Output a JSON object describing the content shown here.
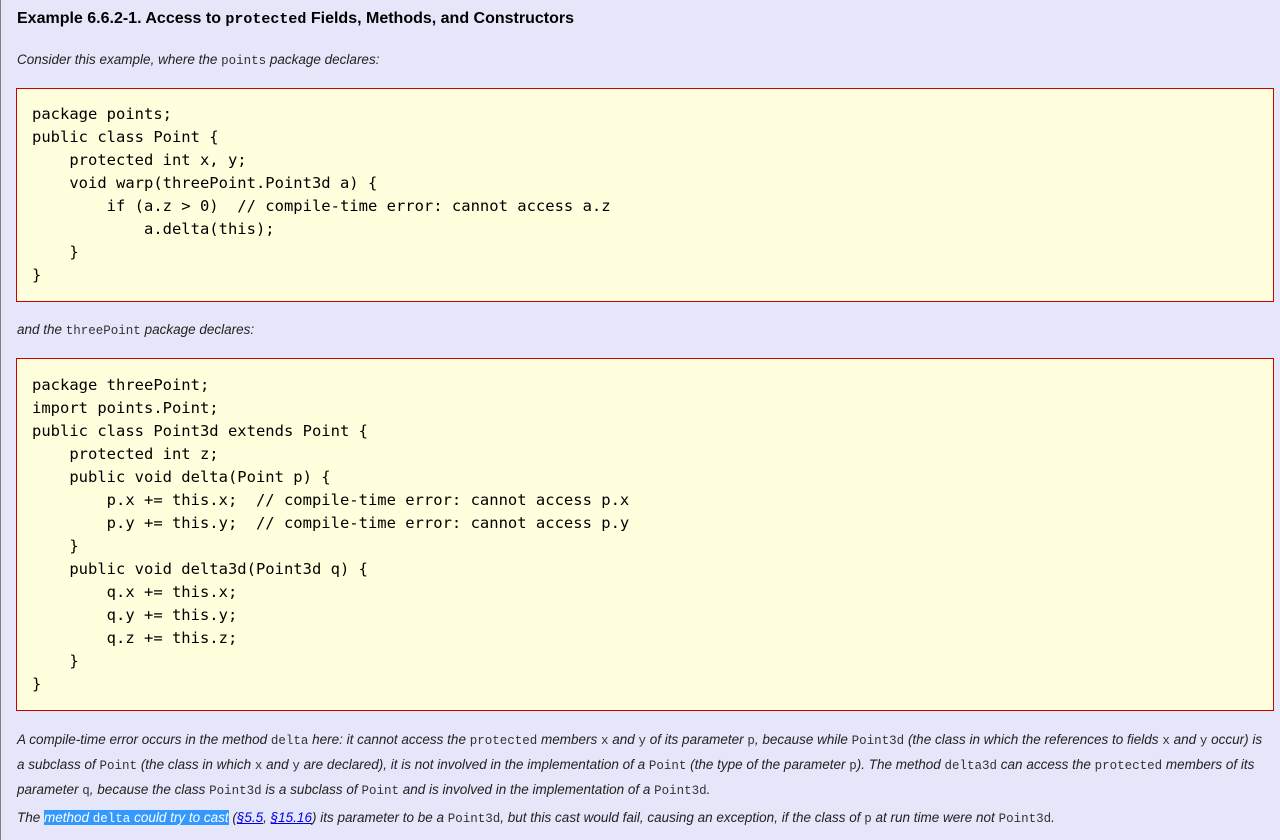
{
  "title": {
    "prefix": "Example 6.6.2-1. Access to ",
    "code": "protected",
    "suffix": " Fields, Methods, and Constructors"
  },
  "intro1": {
    "pre": "Consider this example, where the ",
    "code": "points",
    "post": " package declares:"
  },
  "code1": "package points;\npublic class Point {\n    protected int x, y;\n    void warp(threePoint.Point3d a) {\n        if (a.z > 0)  // compile-time error: cannot access a.z\n            a.delta(this);\n    }\n}",
  "intro2": {
    "pre": "and the ",
    "code": "threePoint",
    "post": " package declares:"
  },
  "code2": "package threePoint;\nimport points.Point;\npublic class Point3d extends Point {\n    protected int z;\n    public void delta(Point p) {\n        p.x += this.x;  // compile-time error: cannot access p.x\n        p.y += this.y;  // compile-time error: cannot access p.y\n    }\n    public void delta3d(Point3d q) {\n        q.x += this.x;\n        q.y += this.y;\n        q.z += this.z;\n    }\n}",
  "explain": {
    "t1": "A compile-time error occurs in the method ",
    "c1": "delta",
    "t2": " here: it cannot access the ",
    "c2": "protected",
    "t3": " members ",
    "c3": "x",
    "t4": " and ",
    "c4": "y",
    "t5": " of its parameter ",
    "c5": "p",
    "t6": ", because while ",
    "c6": "Point3d",
    "t7": " (the class in which the references to fields ",
    "c7": "x",
    "t8": " and ",
    "c8": "y",
    "t9": " occur) is a subclass of ",
    "c9": "Point",
    "t10": " (the class in which ",
    "c10": "x",
    "t11": " and ",
    "c11": "y",
    "t12": " are declared), it is not involved in the implementation of a ",
    "c12": "Point",
    "t13": " (the type of the parameter ",
    "c13": "p",
    "t14": "). The method ",
    "c14": "delta3d",
    "t15": " can access the ",
    "c15": "protected",
    "t16": " members of its parameter ",
    "c16": "q",
    "t17": ", because the class ",
    "c17": "Point3d",
    "t18": " is a subclass of ",
    "c18": "Point",
    "t19": " and is involved in the implementation of a ",
    "c19": "Point3d",
    "t20": "."
  },
  "last": {
    "t1": "The ",
    "hl1": "method ",
    "hlc": "delta",
    "hl2": " could try to cast",
    "t2": " (",
    "link1": "§5.5",
    "t3": ", ",
    "link2": "§15.16",
    "t4": ") its parameter to be a ",
    "c1": "Point3d",
    "t5": ", but this cast would fail, causing an exception, if the class of ",
    "c2": "p",
    "t6": " at run time were not ",
    "c3": "Point3d",
    "t7": "."
  }
}
